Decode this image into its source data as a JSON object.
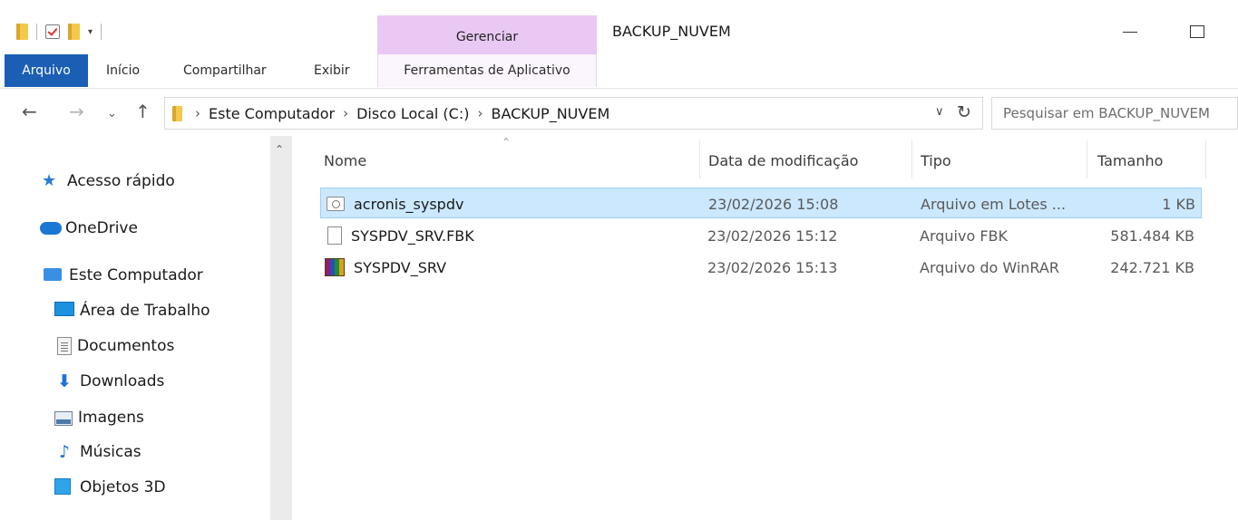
{
  "window": {
    "title": "BACKUP_NUVEM",
    "context_tab_group": "Gerenciar"
  },
  "ribbon": {
    "tabs": [
      {
        "label": "Arquivo"
      },
      {
        "label": "Início"
      },
      {
        "label": "Compartilhar"
      },
      {
        "label": "Exibir"
      },
      {
        "label": "Ferramentas de Aplicativo"
      }
    ]
  },
  "address": {
    "breadcrumbs": [
      "Este Computador",
      "Disco Local (C:)",
      "BACKUP_NUVEM"
    ]
  },
  "search": {
    "placeholder": "Pesquisar em BACKUP_NUVEM"
  },
  "navpane": {
    "items": [
      {
        "label": "Acesso rápido",
        "icon": "star-icon"
      },
      {
        "label": "OneDrive",
        "icon": "cloud-icon"
      },
      {
        "label": "Este Computador",
        "icon": "computer-icon"
      },
      {
        "label": "Área de Trabalho",
        "icon": "desktop-icon"
      },
      {
        "label": "Documentos",
        "icon": "documents-icon"
      },
      {
        "label": "Downloads",
        "icon": "download-icon"
      },
      {
        "label": "Imagens",
        "icon": "pictures-icon"
      },
      {
        "label": "Músicas",
        "icon": "music-icon"
      },
      {
        "label": "Objetos 3D",
        "icon": "cube-icon"
      }
    ]
  },
  "filelist": {
    "columns": [
      "Nome",
      "Data de modificação",
      "Tipo",
      "Tamanho"
    ],
    "rows": [
      {
        "name": "acronis_syspdv",
        "date": "23/02/2026 15:08",
        "type": "Arquivo em Lotes ...",
        "size": "1 KB",
        "icon": "batch-file-icon",
        "selected": true
      },
      {
        "name": "SYSPDV_SRV.FBK",
        "date": "23/02/2026 15:12",
        "type": "Arquivo FBK",
        "size": "581.484 KB",
        "icon": "generic-file-icon",
        "selected": false
      },
      {
        "name": "SYSPDV_SRV",
        "date": "23/02/2026 15:13",
        "type": "Arquivo do WinRAR",
        "size": "242.721 KB",
        "icon": "winrar-icon",
        "selected": false
      }
    ]
  }
}
